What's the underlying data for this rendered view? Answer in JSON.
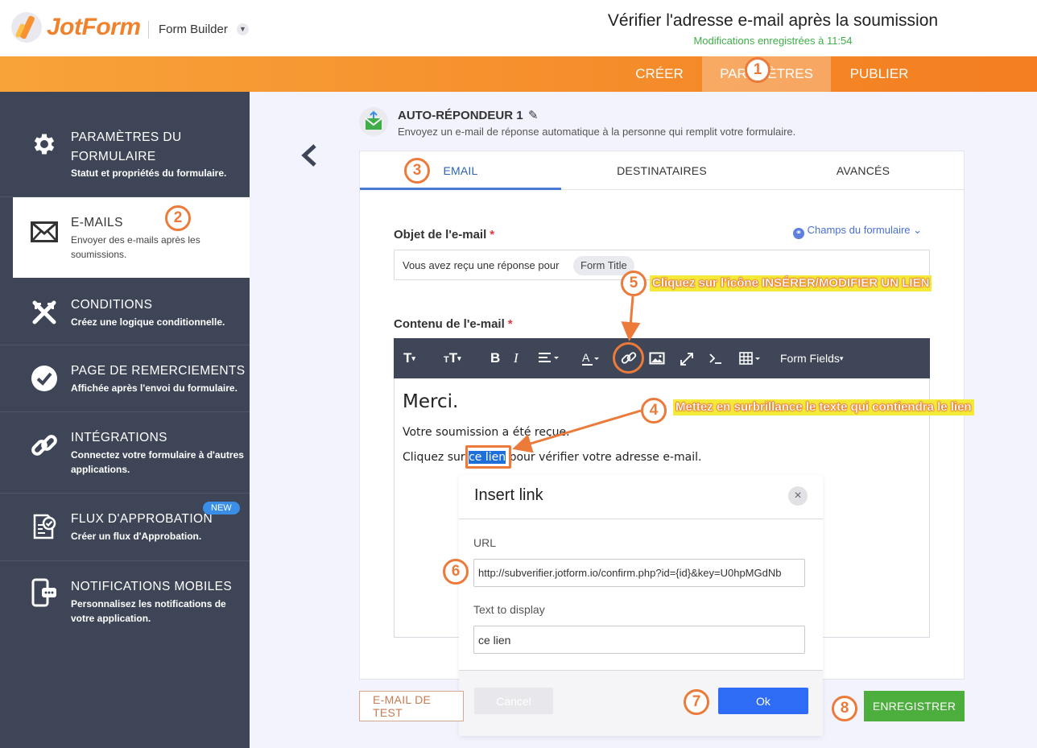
{
  "header": {
    "logo_text": "JotForm",
    "builder_label": "Form Builder",
    "form_title": "Vérifier l'adresse e-mail après la soumission",
    "save_status": "Modifications enregistrées à 11:54"
  },
  "nav": {
    "create": "CRÉER",
    "settings": "PARAMÈTRES",
    "publish": "PUBLIER"
  },
  "sidebar": {
    "items": [
      {
        "title": "PARAMÈTRES DU FORMULAIRE",
        "subtitle": "Statut et propriétés du formulaire."
      },
      {
        "title": "E-MAILS",
        "subtitle": "Envoyer des e-mails après les soumissions."
      },
      {
        "title": "CONDITIONS",
        "subtitle": "Créez une logique conditionnelle."
      },
      {
        "title": "PAGE DE REMERCIEMENTS",
        "subtitle": "Affichée après l'envoi du formulaire."
      },
      {
        "title": "INTÉGRATIONS",
        "subtitle": "Connectez votre formulaire à d'autres applications."
      },
      {
        "title": "FLUX D'APPROBATION",
        "subtitle": "Créer un flux d'Approbation.",
        "badge": "NEW"
      },
      {
        "title": "NOTIFICATIONS MOBILES",
        "subtitle": "Personnalisez les notifications de votre application."
      }
    ]
  },
  "autoresponder": {
    "title": "AUTO-RÉPONDEUR 1",
    "description": "Envoyez un e-mail de réponse automatique à la personne qui remplit votre formulaire."
  },
  "tabs": {
    "email": "EMAIL",
    "recipients": "DESTINATAIRES",
    "advanced": "AVANCÉS"
  },
  "subject": {
    "label": "Objet de l'e-mail",
    "required_mark": "*",
    "fields_link": "Champs du formulaire",
    "text": "Vous avez reçu une réponse pour",
    "chip": "Form Title"
  },
  "content": {
    "label": "Contenu de l'e-mail",
    "required_mark": "*",
    "toolbar_form_fields": "Form Fields",
    "heading": "Merci.",
    "line1": "Votre soumission a été reçue.",
    "line2_before": "Cliquez sur",
    "line2_link": "ce lien",
    "line2_after": "pour vérifier votre adresse e-mail."
  },
  "dialog": {
    "title": "Insert link",
    "url_label": "URL",
    "url_value": "http://subverifier.jotform.io/confirm.php?id={id}&key=U0hpMGdNb",
    "text_label": "Text to display",
    "text_value": "ce lien",
    "cancel": "Cancel",
    "ok": "Ok"
  },
  "actions": {
    "test_email": "E-MAIL DE TEST",
    "save": "ENREGISTRER"
  },
  "annotations": {
    "steps": [
      "1",
      "2",
      "3",
      "4",
      "5",
      "6",
      "7",
      "8"
    ],
    "callout_5": "Cliquez sur l'icône  INSÉRER/MODIFIER UN LIEN",
    "callout_4": "Mettez en surbrillance le texte qui contiendra le lien",
    "color": "#ec7a3a"
  },
  "colors": {
    "brand_orange": "#f37d20",
    "sidebar_bg": "#3d4557",
    "accent_blue": "#2f6cf6",
    "save_green": "#4cae3c"
  }
}
